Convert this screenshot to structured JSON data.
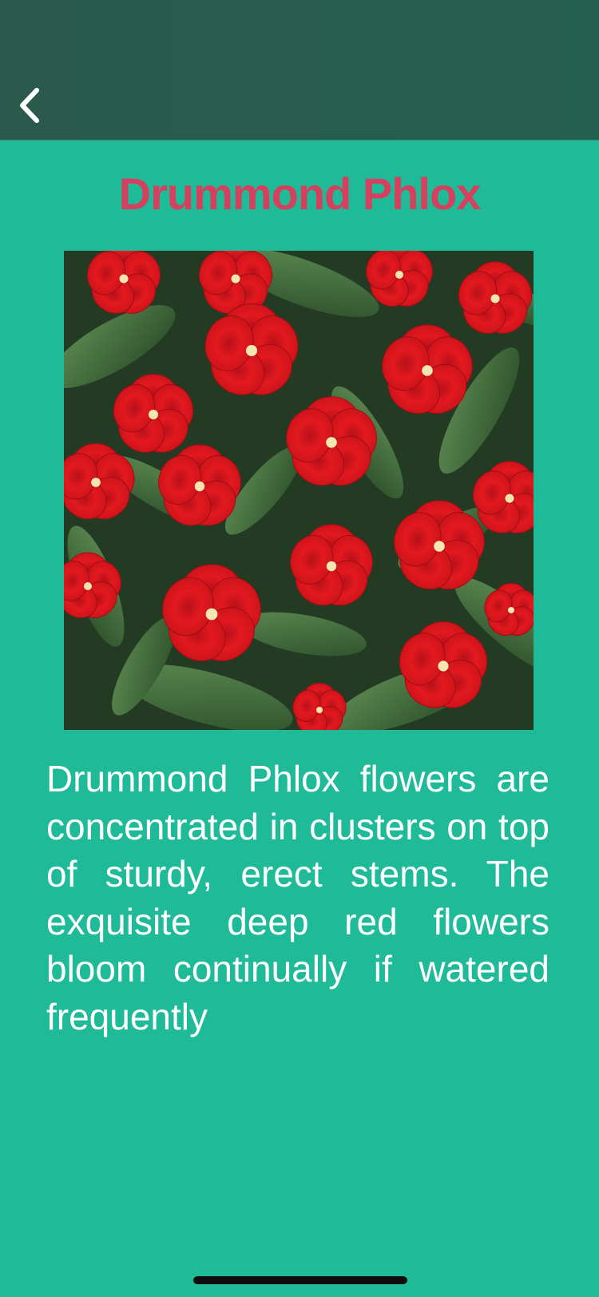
{
  "nav": {
    "back_icon": "chevron-left-icon"
  },
  "flower": {
    "name": "Drummond Phlox",
    "description": "Drummond Phlox flowers are concentrated in clusters on top of sturdy, erect stems. The exquisite deep red flowers bloom continually if watered frequently",
    "image_subject": "red-flowers-photo"
  },
  "colors": {
    "background": "#1fbb99",
    "nav_bar": "#285c4e",
    "title": "#d4405e",
    "body_text": "#ffffff",
    "flower_red": "#e21b1e",
    "leaf_green": "#3f6f3a"
  }
}
